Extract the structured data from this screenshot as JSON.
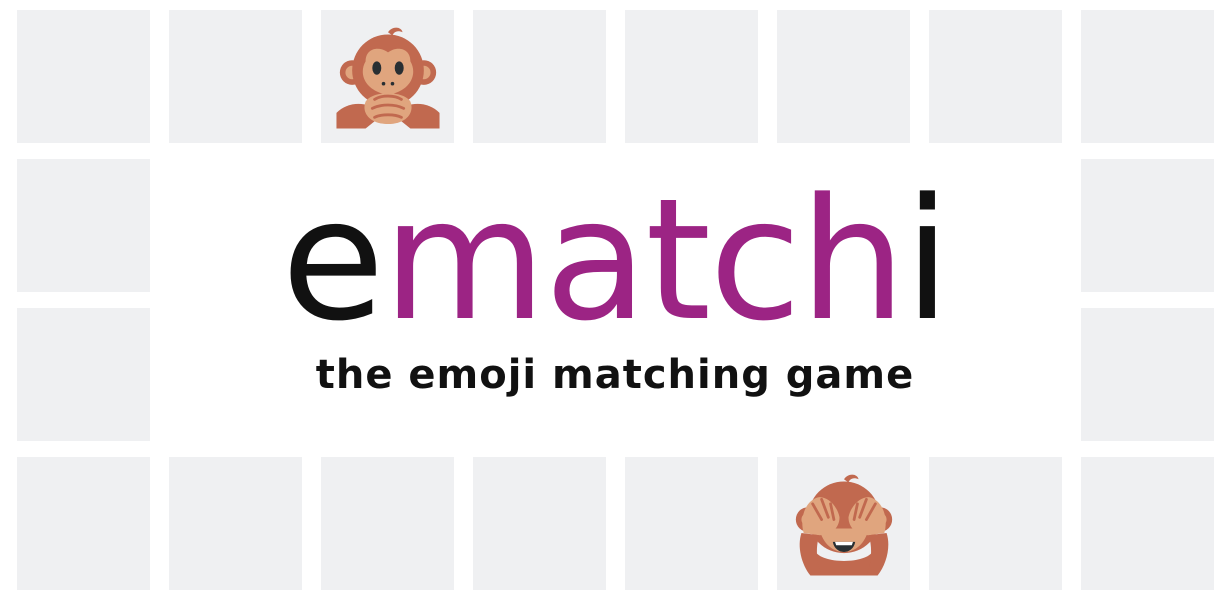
{
  "logo": {
    "part_1": "e",
    "part_2": "matc",
    "part_3": "h",
    "part_4": "i",
    "tagline": "the emoji matching game"
  },
  "colors": {
    "tile": "#eff0f2",
    "logo_dark": "#111111",
    "logo_accent": "#9c2484"
  },
  "board": {
    "tiles": [
      {
        "icon": null
      },
      {
        "icon": null
      },
      {
        "icon": "speak-no-evil-monkey-icon"
      },
      {
        "icon": null
      },
      {
        "icon": null
      },
      {
        "icon": null
      },
      {
        "icon": null
      },
      {
        "icon": null
      },
      {
        "icon": null
      },
      {
        "icon": null
      },
      {
        "icon": null
      },
      {
        "icon": null
      },
      {
        "icon": null
      },
      {
        "icon": null
      },
      {
        "icon": null
      },
      {
        "icon": null
      },
      {
        "icon": null
      },
      {
        "icon": "see-no-evil-monkey-icon"
      },
      {
        "icon": null
      },
      {
        "icon": null
      }
    ]
  }
}
